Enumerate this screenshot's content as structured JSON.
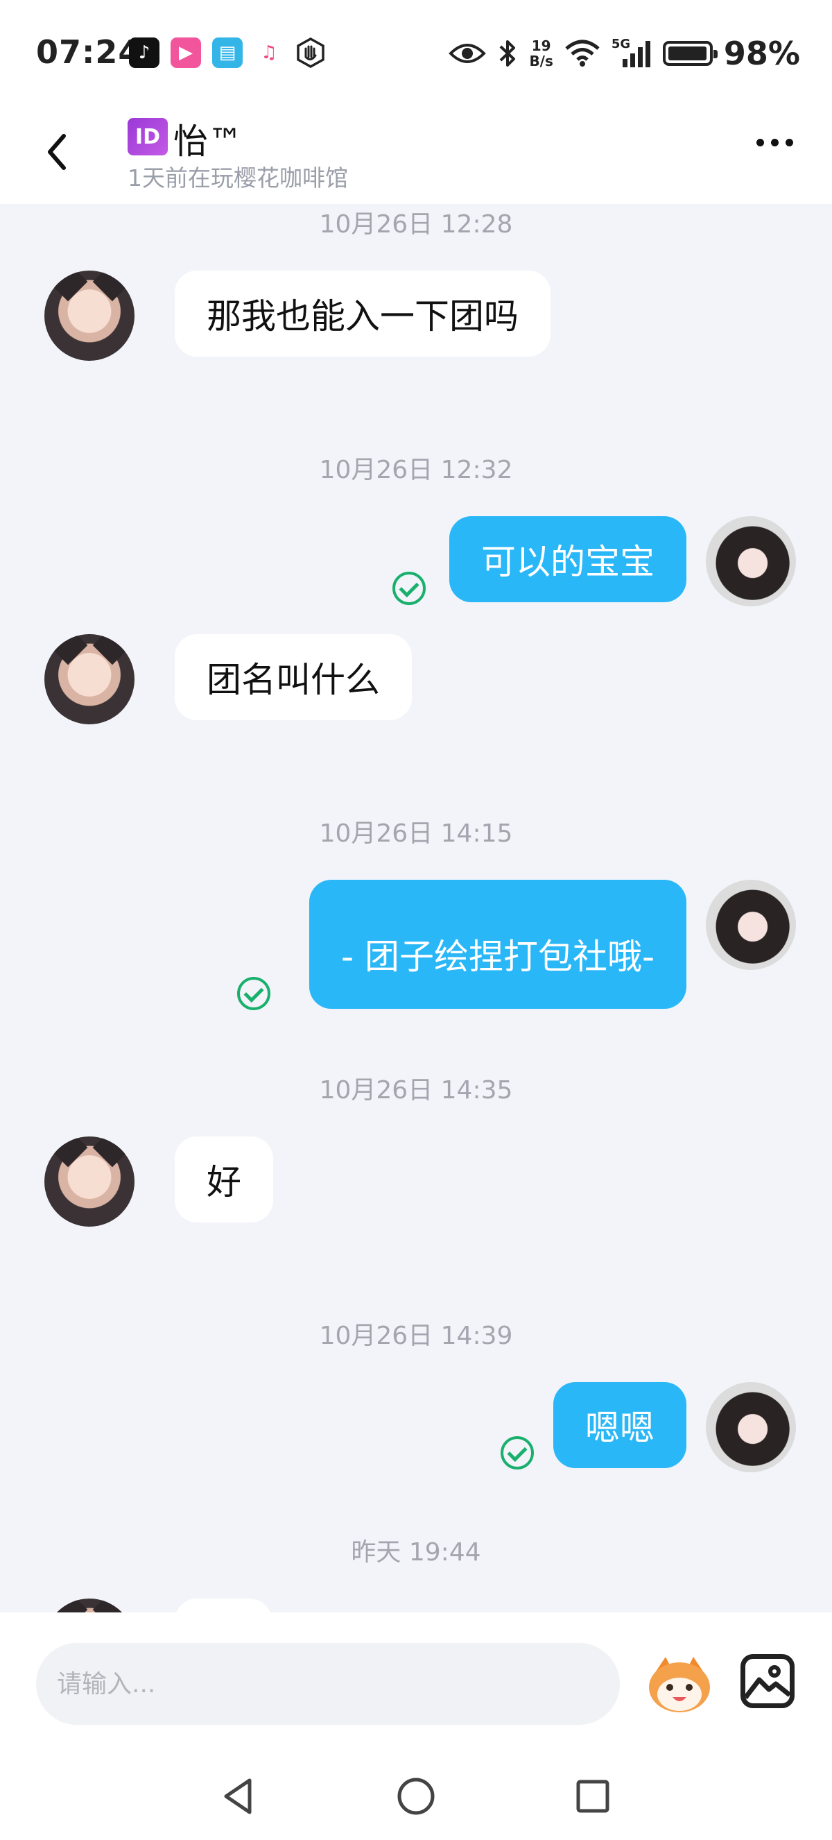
{
  "status_bar": {
    "time": "07:24",
    "net_speed_value": "19",
    "net_speed_unit": "B/s",
    "network": "5G",
    "battery": "98%",
    "battery_level": 0.98
  },
  "header": {
    "id_badge": "ID",
    "name": "怡™",
    "subtitle": "1天前在玩樱花咖啡馆"
  },
  "chat": {
    "timestamps": [
      "10月26日 12:28",
      "10月26日 12:32",
      "10月26日 14:15",
      "10月26日 14:35",
      "10月26日 14:39",
      "昨天 19:44"
    ],
    "messages": [
      {
        "from": "them",
        "text": "那我也能入一下团吗"
      },
      {
        "from": "me",
        "text": "可以的宝宝",
        "read": true
      },
      {
        "from": "them",
        "text": "团名叫什么"
      },
      {
        "from": "me",
        "text": "- 团子绘捏打包社哦-",
        "read": true
      },
      {
        "from": "them",
        "text": "好"
      },
      {
        "from": "me",
        "text": "嗯嗯",
        "read": true
      }
    ]
  },
  "input": {
    "placeholder": "请输入..."
  },
  "colors": {
    "my_bubble": "#2ab7f8",
    "their_bubble": "#ffffff",
    "read_check": "#19b06e",
    "background": "#f2f4f9"
  }
}
